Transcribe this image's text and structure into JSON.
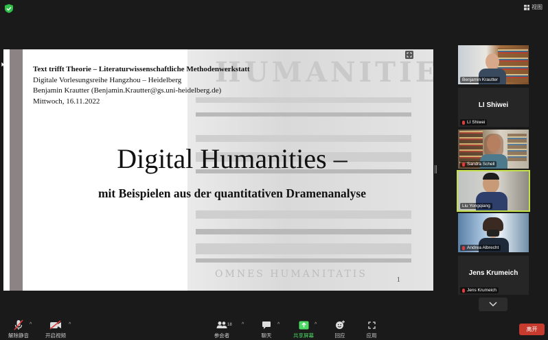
{
  "top": {
    "view_label": "视图"
  },
  "slide": {
    "meta_line1": "Text trifft Theorie – Literaturwissenschaftliche Methodenwerkstatt",
    "meta_line2": "Digitale Vorlesungsreihe Hangzhou – Heidelberg",
    "meta_line3": "Benjamin Krautter (Benjamin.Krautter@gs.uni-heidelberg.de)",
    "meta_line4": "Mittwoch, 16.11.2022",
    "title": "Digital Humanities –",
    "subtitle": "mit Beispielen aus der quantitativen Dramenanalyse",
    "page_number": "1",
    "watermark_top": "HUMANITIES",
    "watermark_bottom": "OMNES HUMANITATIS"
  },
  "participants": [
    {
      "name": "Benjamin Krautter",
      "video": true
    },
    {
      "name": "LI Shiwei",
      "display_name": "LI Shiwei",
      "video": false
    },
    {
      "name": "Sandra Schell",
      "video": true
    },
    {
      "name": "Liu Yongqiang",
      "video": true,
      "active_speaker": true
    },
    {
      "name": "Andrea Albrecht",
      "video": true
    },
    {
      "name": "Jens Krumeich",
      "display_name": "Jens Krumeich",
      "video": false
    }
  ],
  "toolbar": {
    "unmute": "解除静音",
    "start_video": "开启视频",
    "participants": "参会者",
    "participants_count": "18",
    "chat": "聊天",
    "share_screen": "共享屏幕",
    "reactions": "回应",
    "apps": "应用",
    "leave": "离开"
  },
  "colors": {
    "background": "#1a1a1a",
    "active_speaker_border": "#c4e14a",
    "share_green": "#4cd964",
    "leave_red": "#c63b2d"
  }
}
